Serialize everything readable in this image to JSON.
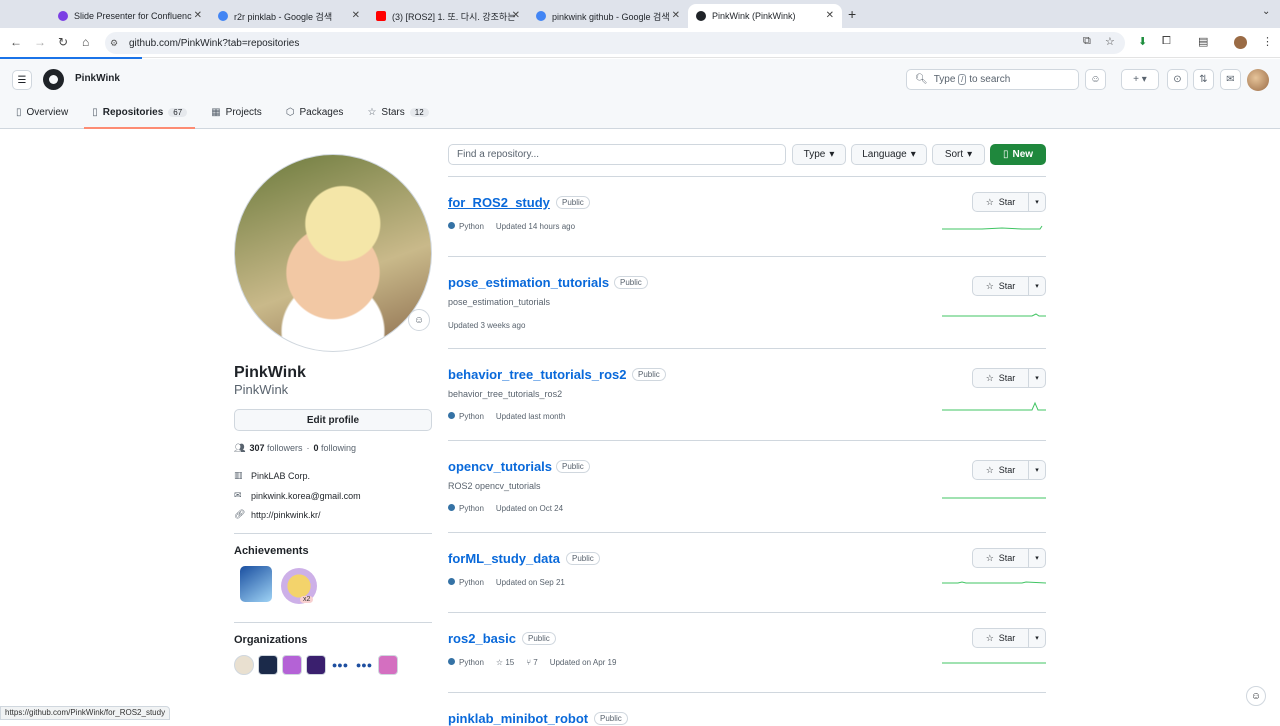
{
  "browser": {
    "tabs": [
      {
        "title": "Slide Presenter for Confluenc",
        "color": "#7b3fe4"
      },
      {
        "title": "r2r pinklab - Google 검색",
        "color": "#4285f4"
      },
      {
        "title": "(3) [ROS2] 1. 또. 다시. 강조하는",
        "color": "#ff0000"
      },
      {
        "title": "pinkwink github - Google 검색",
        "color": "#4285f4"
      },
      {
        "title": "PinkWink (PinkWink)",
        "color": "#1f2328"
      }
    ],
    "url": "github.com/PinkWink?tab=repositories"
  },
  "header": {
    "username": "PinkWink",
    "search_prefix": "Type",
    "search_key": "/",
    "search_suffix": "to search"
  },
  "nav": {
    "items": [
      {
        "label": "Overview",
        "icon": "book-icon"
      },
      {
        "label": "Repositories",
        "icon": "repo-icon",
        "count": "67"
      },
      {
        "label": "Projects",
        "icon": "table-icon"
      },
      {
        "label": "Packages",
        "icon": "package-icon"
      },
      {
        "label": "Stars",
        "icon": "star-icon",
        "count": "12"
      }
    ]
  },
  "profile": {
    "name": "PinkWink",
    "login": "PinkWink",
    "edit_label": "Edit profile",
    "followers": "307",
    "followers_label": "followers",
    "following": "0",
    "following_label": "following",
    "company": "PinkLAB Corp.",
    "email": "pinkwink.korea@gmail.com",
    "website": "http://pinkwink.kr/",
    "achievements_title": "Achievements",
    "achievement_multiplier": "x2",
    "organizations_title": "Organizations"
  },
  "filters": {
    "find_placeholder": "Find a repository...",
    "type_label": "Type",
    "language_label": "Language",
    "sort_label": "Sort",
    "new_label": "New"
  },
  "repos": [
    {
      "name": "for_ROS2_study",
      "visibility": "Public",
      "description": "",
      "language": "Python",
      "updated": "Updated 14 hours ago",
      "stars": "",
      "forks": "",
      "star_label": "Star"
    },
    {
      "name": "pose_estimation_tutorials",
      "visibility": "Public",
      "description": "pose_estimation_tutorials",
      "language": "",
      "updated": "Updated 3 weeks ago",
      "stars": "",
      "forks": "",
      "star_label": "Star"
    },
    {
      "name": "behavior_tree_tutorials_ros2",
      "visibility": "Public",
      "description": "behavior_tree_tutorials_ros2",
      "language": "Python",
      "updated": "Updated last month",
      "stars": "",
      "forks": "",
      "star_label": "Star"
    },
    {
      "name": "opencv_tutorials",
      "visibility": "Public",
      "description": "ROS2 opencv_tutorials",
      "language": "Python",
      "updated": "Updated on Oct 24",
      "stars": "",
      "forks": "",
      "star_label": "Star"
    },
    {
      "name": "forML_study_data",
      "visibility": "Public",
      "description": "",
      "language": "Python",
      "updated": "Updated on Sep 21",
      "stars": "",
      "forks": "",
      "star_label": "Star"
    },
    {
      "name": "ros2_basic",
      "visibility": "Public",
      "description": "",
      "language": "Python",
      "updated": "Updated on Apr 19",
      "stars": "15",
      "forks": "7",
      "star_label": "Star"
    },
    {
      "name": "pinklab_minibot_robot",
      "visibility": "Public",
      "description": "",
      "language": "",
      "updated": "",
      "stars": "",
      "forks": "",
      "star_label": ""
    }
  ],
  "status_url": "https://github.com/PinkWink/for_ROS2_study",
  "colors": {
    "accent": "#0969da",
    "new_button": "#1f883d",
    "python": "#3572A5",
    "tab_underline": "#fd8c73"
  }
}
